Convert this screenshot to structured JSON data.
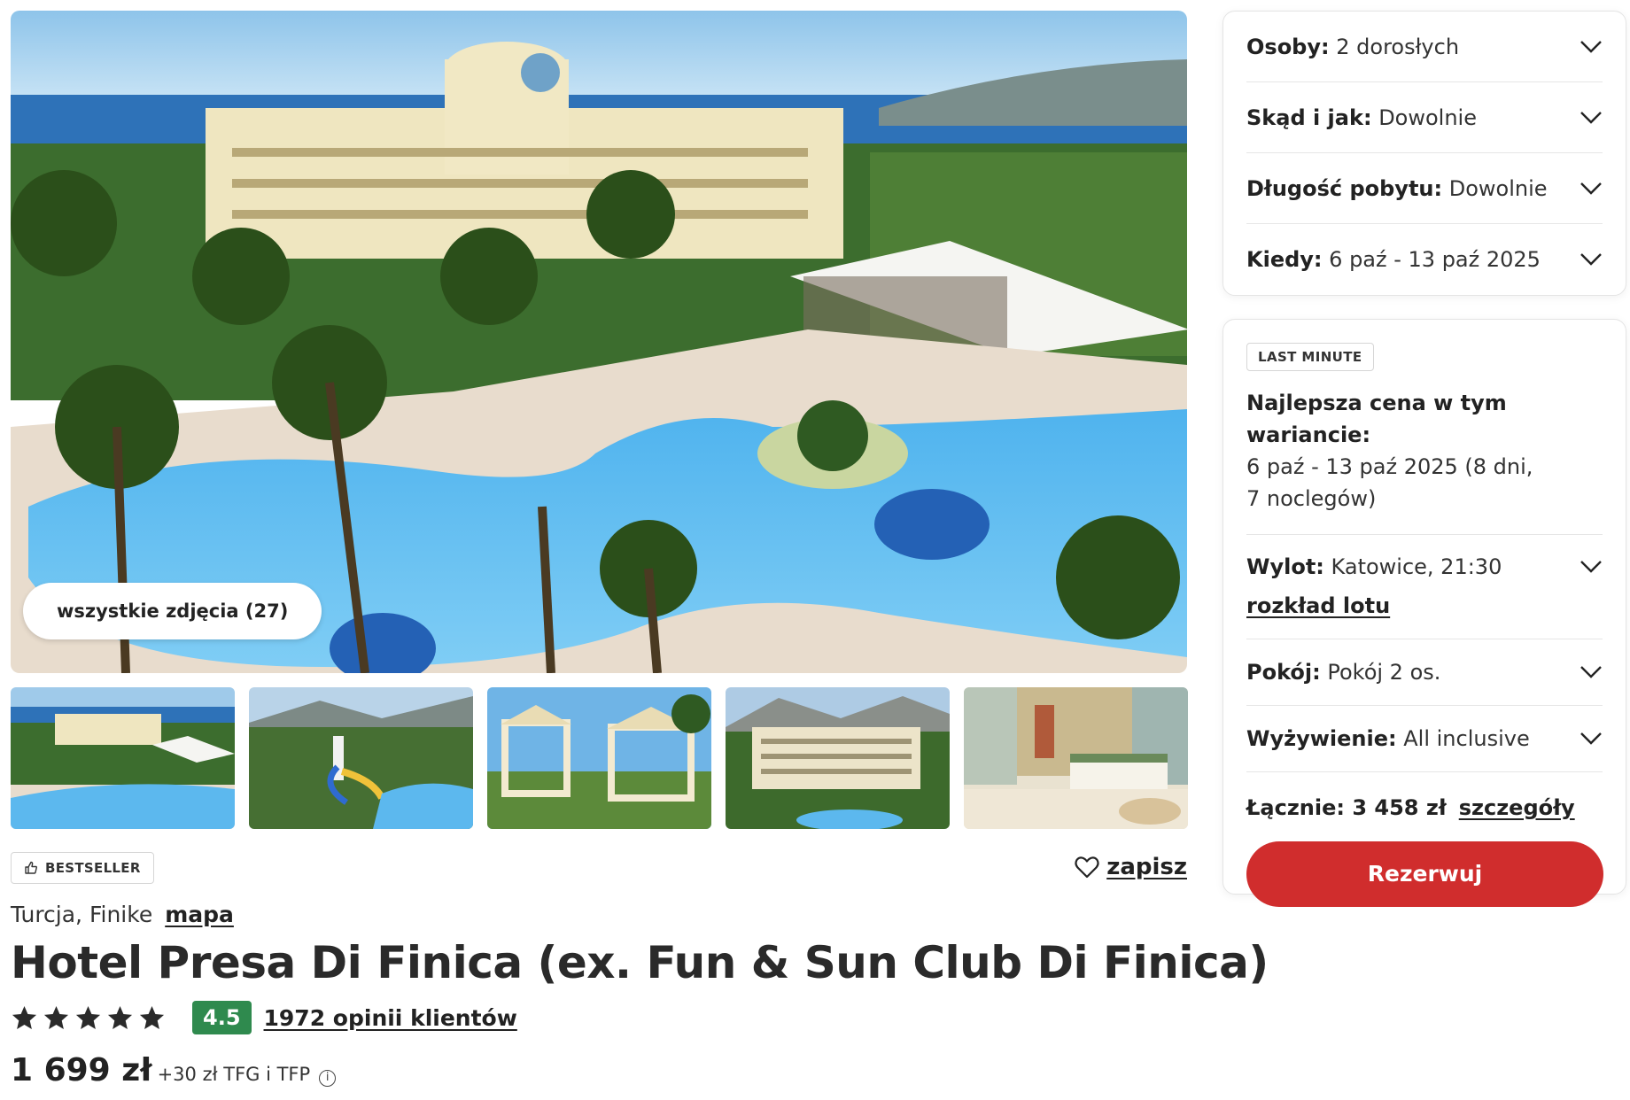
{
  "gallery": {
    "all_photos_label": "wszystkie zdjęcia (27)"
  },
  "badges": {
    "bestseller": "BESTSELLER"
  },
  "save": {
    "label": "zapisz"
  },
  "hotel": {
    "location": "Turcja, Finike",
    "map_link": "mapa",
    "name": "Hotel Presa Di Finica (ex. Fun & Sun Club Di Finica)",
    "stars": 5,
    "score": "4.5",
    "reviews_link": "1972 opinii klientów",
    "price": "1 699 zł",
    "price_extra": "+30 zł TFG i TFP",
    "info_icon": "ⓘ"
  },
  "filters": [
    {
      "label": "Osoby:",
      "value": "2 dorosłych"
    },
    {
      "label": "Skąd i jak:",
      "value": "Dowolnie"
    },
    {
      "label": "Długość pobytu:",
      "value": "Dowolnie"
    },
    {
      "label": "Kiedy:",
      "value": "6 paź - 13 paź 2025"
    }
  ],
  "offer": {
    "badge": "LAST MINUTE",
    "best_title": "Najlepsza cena w tym wariancie:",
    "best_text": "6 paź - 13 paź 2025 (8 dni, 7 noclegów)",
    "flight_label": "Wylot:",
    "flight_value": "Katowice, 21:30",
    "flight_schedule": "rozkład lotu",
    "room_label": "Pokój:",
    "room_value": "Pokój 2 os.",
    "board_label": "Wyżywienie:",
    "board_value": "All inclusive",
    "total_label": "Łącznie: 3 458 zł",
    "details_link": "szczegóły",
    "book_button": "Rezerwuj"
  },
  "colors": {
    "primary_red": "#d02d2d",
    "score_green": "#2f8a4e"
  }
}
